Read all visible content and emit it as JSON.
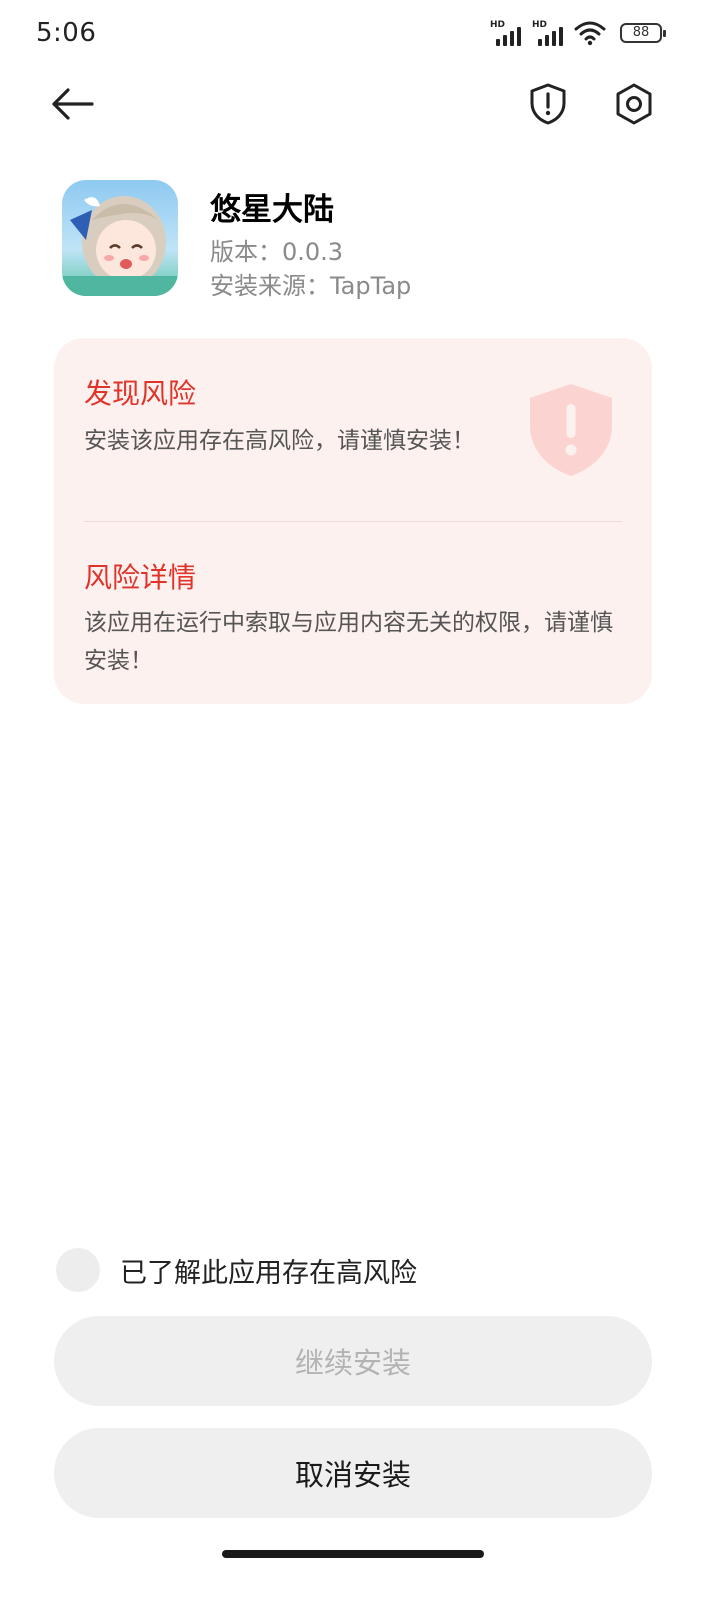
{
  "status_bar": {
    "time": "5:06",
    "signal1_label": "HD",
    "signal2_label": "HD",
    "battery": "88",
    "icons": [
      "signal-hd-icon",
      "signal-hd-icon",
      "wifi-icon",
      "battery-icon"
    ]
  },
  "header": {
    "icons": [
      "back-arrow-icon",
      "shield-alert-icon",
      "settings-icon"
    ]
  },
  "app": {
    "name": "悠星大陆",
    "version": "版本：0.0.3",
    "source": "安装来源：TapTap"
  },
  "risk": {
    "title": "发现风险",
    "description": "安装该应用存在高风险，请谨慎安装！",
    "detail_title": "风险详情",
    "detail_description": "该应用在运行中索取与应用内容无关的权限，请谨慎安装！"
  },
  "actions": {
    "acknowledge_label": "已了解此应用存在高风险",
    "acknowledge_checked": false,
    "continue_label": "继续安装",
    "cancel_label": "取消安装"
  },
  "colors": {
    "risk_red": "#e0342a",
    "card_bg": "#fdf1ef",
    "button_bg": "#efefef",
    "disabled_text": "#b3b3b3"
  }
}
